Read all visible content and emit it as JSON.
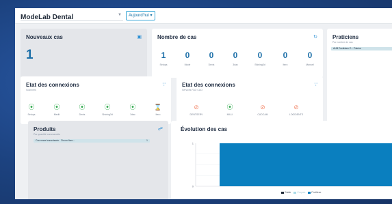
{
  "header": {
    "lab_name": "ModeLab Dental",
    "period": "Aujourd'hui ▾"
  },
  "new_cases": {
    "title": "Nouveaux cas",
    "value": "1"
  },
  "case_count": {
    "title": "Nombre de cas",
    "items": [
      {
        "value": "1",
        "label": "Setups"
      },
      {
        "value": "0",
        "label": "Modè"
      },
      {
        "value": "0",
        "label": "Devis"
      },
      {
        "value": "0",
        "label": "3dac"
      },
      {
        "value": "0",
        "label": "Shining3d"
      },
      {
        "value": "0",
        "label": "Itero"
      },
      {
        "value": "0",
        "label": "Manuel"
      }
    ]
  },
  "practitioners": {
    "title": "Praticiens",
    "subtitle": "Par nombre de cas",
    "row_label": "AUB Dentistes C... Patrice"
  },
  "connections_scanners": {
    "title": "Etat des connexions",
    "subtitle": "Scanners",
    "items": [
      {
        "label": "Setups",
        "status": "ok"
      },
      {
        "label": "Medit",
        "status": "ok"
      },
      {
        "label": "Dexis",
        "status": "ok"
      },
      {
        "label": "Shining3d",
        "status": "ok"
      },
      {
        "label": "3dac",
        "status": "ok"
      },
      {
        "label": "Itero",
        "status": "warn"
      }
    ]
  },
  "connections_services": {
    "title": "Etat des connexions",
    "subtitle": "Services FAO CAO",
    "items": [
      {
        "label": "DENTSERV",
        "status": "err"
      },
      {
        "label": "MILLI",
        "status": "ok"
      },
      {
        "label": "CADCAM",
        "status": "err"
      },
      {
        "label": "LOGIDENTS",
        "status": "err"
      }
    ]
  },
  "products": {
    "title": "Produits",
    "subtitle": "Par quantité commandée",
    "row_label": "Couronne transvissée - Zircon fiom...",
    "row_value": "1"
  },
  "chart_data": {
    "type": "bar",
    "title": "Évolution des cas",
    "categories": [
      ""
    ],
    "series": [
      {
        "name": "Guide",
        "values": [
          0
        ],
        "color": "#1f2937"
      },
      {
        "name": "Coques",
        "values": [
          0
        ],
        "color": "#a9dbe8"
      },
      {
        "name": "Prothèse",
        "values": [
          1
        ],
        "color": "#0a7fbf"
      }
    ],
    "ylim": [
      0,
      1
    ],
    "yticks": [
      "1",
      "",
      "",
      "",
      "0"
    ]
  },
  "icons": {
    "new_cases": "expand-icon",
    "case_count": "refresh-icon",
    "connections": "rss-icon",
    "products": "cart-icon"
  }
}
